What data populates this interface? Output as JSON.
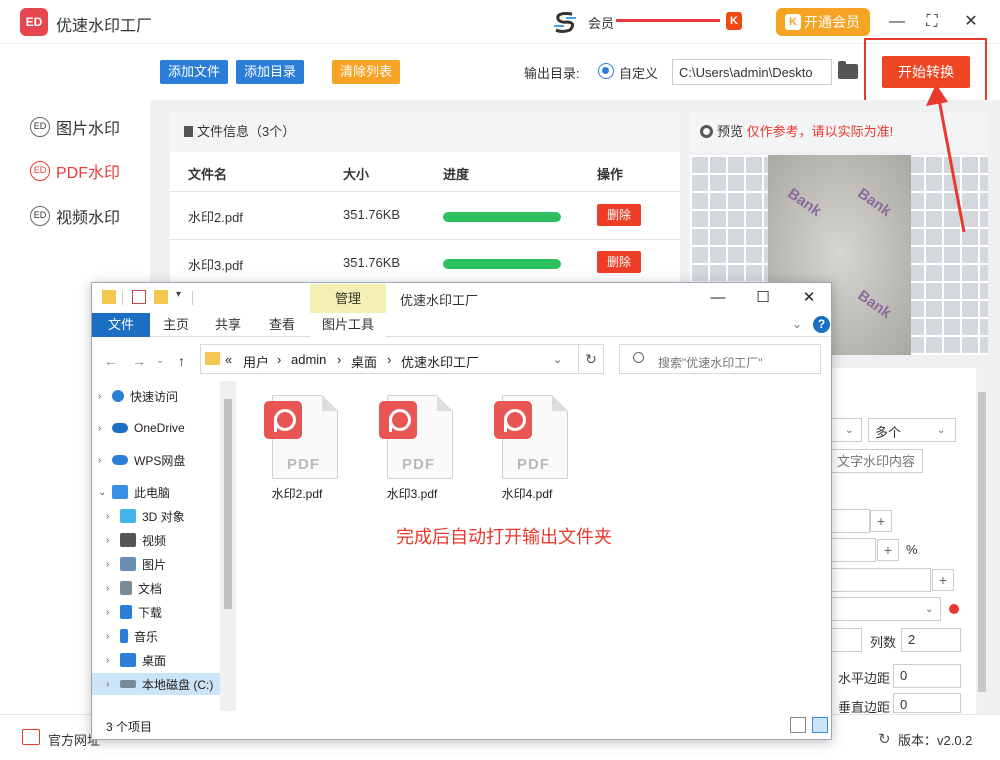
{
  "app": {
    "logo_text": "ED",
    "title": "优速水印工厂",
    "member_label": "会员",
    "k_badge": "K",
    "vip_button": "开通会员",
    "minimize": "—",
    "maximize": "⛶",
    "close": "✕"
  },
  "sidebar": {
    "items": [
      {
        "icon_text": "ED",
        "label": "图片水印",
        "active": false
      },
      {
        "icon_text": "ED",
        "label": "PDF水印",
        "active": true
      },
      {
        "icon_text": "ED",
        "label": "视频水印",
        "active": false
      }
    ]
  },
  "toolbar": {
    "add_file": "添加文件",
    "add_dir": "添加目录",
    "clear_list": "清除列表",
    "output_label": "输出目录:",
    "radio_label": "自定义",
    "output_path": "C:\\Users\\admin\\Deskto",
    "start_button": "开始转换"
  },
  "file_panel": {
    "header": "文件信息（3个）",
    "columns": [
      "文件名",
      "大小",
      "进度",
      "操作"
    ],
    "rows": [
      {
        "name": "水印2.pdf",
        "size": "351.76KB",
        "progress": 1.0,
        "action": "删除"
      },
      {
        "name": "水印3.pdf",
        "size": "351.76KB",
        "progress": 1.0,
        "action": "删除"
      }
    ]
  },
  "preview": {
    "label": "预览",
    "note": "仅作参考，请以实际为准!",
    "watermark_text": "Bank"
  },
  "settings": {
    "select_multi": "多个",
    "text_placeholder": "文字水印内容",
    "percent": "%",
    "cols_label": "列数",
    "cols_value": "2",
    "h_margin_label": "水平边距",
    "h_margin_value": "0",
    "v_margin_label": "垂直边距",
    "v_margin_value": "0",
    "plus": "+"
  },
  "bottombar": {
    "official_site": "官方网址",
    "version_label": "版本：v2.0.2"
  },
  "explorer": {
    "manage_tab": "管理",
    "title": "优速水印工厂",
    "minimize": "—",
    "maximize": "☐",
    "close": "✕",
    "ribbon": [
      "文件",
      "主页",
      "共享",
      "查看",
      "图片工具"
    ],
    "help": "?",
    "breadcrumb": [
      "«",
      "用户",
      "›",
      "admin",
      "›",
      "桌面",
      "›",
      "优速水印工厂"
    ],
    "search_placeholder": "搜索\"优速水印工厂\"",
    "nav": [
      {
        "label": "快速访问",
        "icon": "star-icon",
        "color": "#2b7ed8"
      },
      {
        "label": "OneDrive",
        "icon": "cloud-icon",
        "color": "#1a6fc2"
      },
      {
        "label": "WPS网盘",
        "icon": "wps-cloud-icon",
        "color": "#2b7ed8"
      },
      {
        "label": "此电脑",
        "icon": "computer-icon",
        "color": "#3a8ee6"
      },
      {
        "label": "3D 对象",
        "icon": "cube-icon",
        "color": "#46b3e6"
      },
      {
        "label": "视频",
        "icon": "video-icon",
        "color": "#555555"
      },
      {
        "label": "图片",
        "icon": "picture-icon",
        "color": "#6a8fb5"
      },
      {
        "label": "文档",
        "icon": "document-icon",
        "color": "#7a8a99"
      },
      {
        "label": "下载",
        "icon": "download-icon",
        "color": "#2b7ed8"
      },
      {
        "label": "音乐",
        "icon": "music-icon",
        "color": "#2b7ed8"
      },
      {
        "label": "桌面",
        "icon": "desktop-icon",
        "color": "#2b7ed8"
      },
      {
        "label": "本地磁盘 (C:)",
        "icon": "drive-icon",
        "color": "#7a8a99"
      }
    ],
    "files": [
      "水印2.pdf",
      "水印3.pdf",
      "水印4.pdf"
    ],
    "pdf_word": "PDF",
    "note": "完成后自动打开输出文件夹",
    "status": "3 个项目"
  }
}
